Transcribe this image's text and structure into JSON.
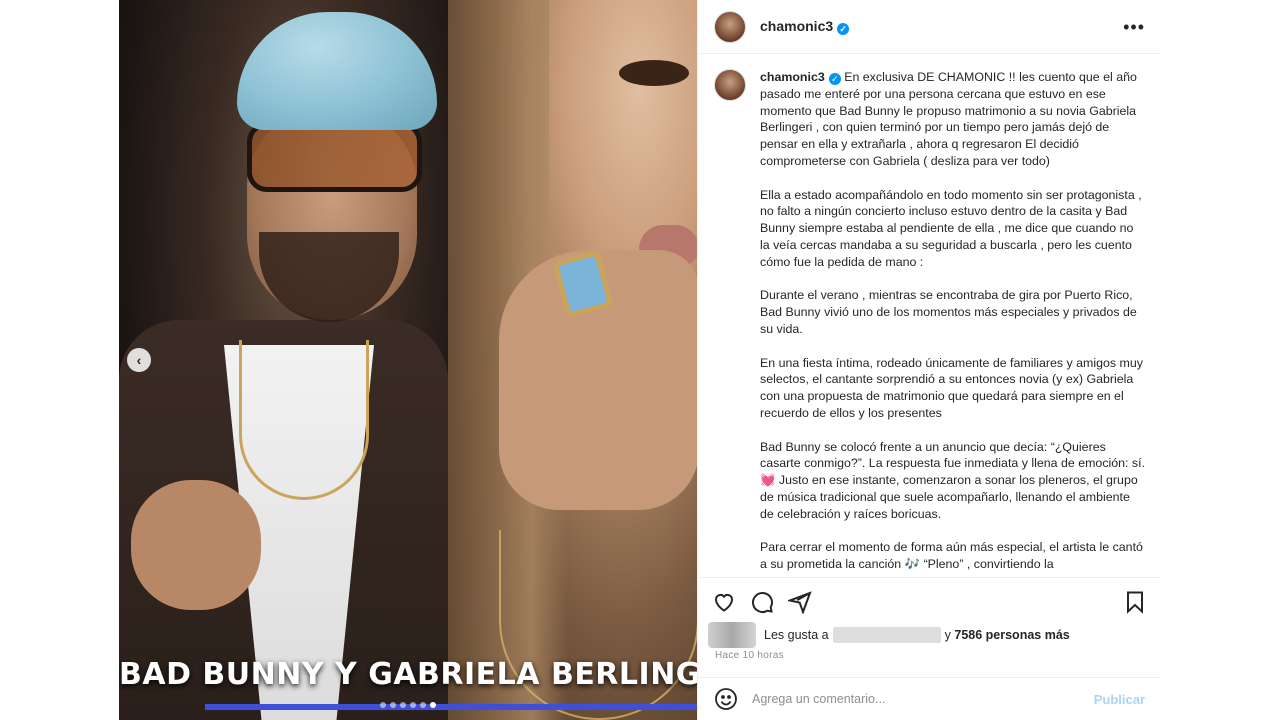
{
  "media": {
    "overlay_caption": "BAD BUNNY Y GABRIELA BERLING",
    "prev_icon": "chevron-left-icon",
    "slide_count": 6,
    "active_slide": 6,
    "colors": {
      "progress": "#3f4fd8"
    }
  },
  "post": {
    "author": "chamonic3",
    "verified": true
  },
  "caption": {
    "username": "chamonic3",
    "paragraphs": [
      "En exclusiva DE CHAMONIC !! les cuento que el año pasado me enteré por una persona cercana que estuvo en ese momento que Bad Bunny le propuso matrimonio a su novia Gabriela Berlingeri , con quien terminó por un tiempo pero jamás dejó de pensar en ella y extrañarla , ahora q regresaron El decidió comprometerse con Gabriela ( desliza para ver todo)",
      "Ella a estado acompañándolo en todo momento sin ser protagonista , no falto a ningún concierto incluso estuvo dentro de la casita y Bad Bunny siempre estaba al pendiente de ella , me dice que cuando no la veía cercas mandaba a su seguridad a buscarla , pero les cuento cómo fue la pedida de mano :",
      "Durante el verano , mientras se encontraba de gira por Puerto Rico, Bad Bunny vivió uno de los momentos más especiales y privados de su vida.",
      "En una fiesta íntima, rodeado únicamente de familiares y amigos muy selectos, el cantante sorprendió a su entonces novia (y ex) Gabriela con una propuesta de matrimonio que quedará para siempre en el recuerdo de ellos y los presentes",
      "Bad Bunny se colocó frente a un anuncio que decía: “¿Quieres casarte conmigo?”. La respuesta fue inmediata y llena de emoción: sí. 💓 Justo en ese instante, comenzaron a sonar los pleneros, el grupo de música tradicional que suele acompañarlo, llenando el ambiente de celebración y raíces boricuas.",
      "Para cerrar el momento de forma aún más especial, el artista le cantó a su prometida la canción 🎶 “Pleno” , convirtiendo la"
    ]
  },
  "actions": {
    "like_icon": "heart-icon",
    "comment_icon": "comment-icon",
    "share_icon": "share-icon",
    "save_icon": "bookmark-icon"
  },
  "likes": {
    "prefix": "Les gusta a",
    "suffix": "y",
    "others": "7586 personas más"
  },
  "timestamp": "Hace 10 horas",
  "comment_box": {
    "emoji_icon": "emoji-icon",
    "placeholder": "Agrega un comentario...",
    "post_label": "Publicar"
  }
}
